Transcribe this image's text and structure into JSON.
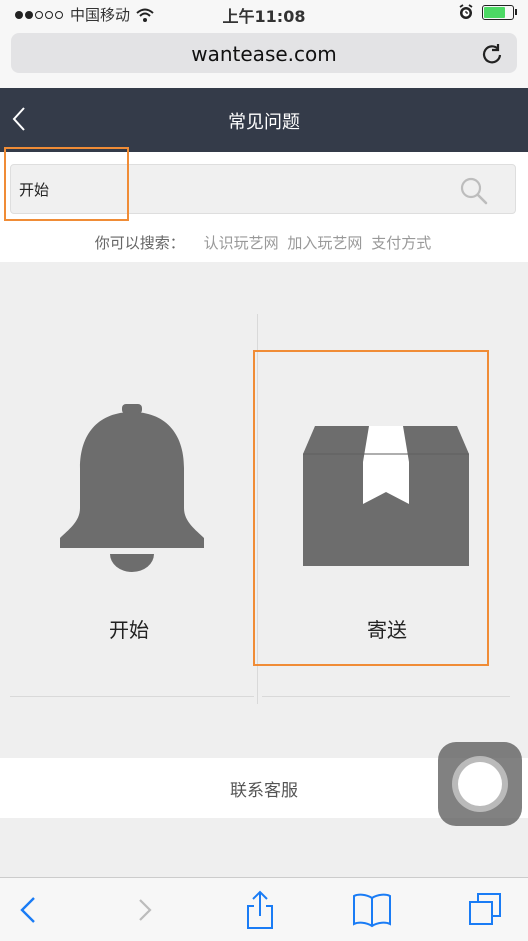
{
  "status_bar": {
    "carrier": "中国移动",
    "time": "上午11:08"
  },
  "browser": {
    "url": "wantease.com"
  },
  "header": {
    "title": "常见问题"
  },
  "search": {
    "value": "开始",
    "hint_label": "你可以搜索：",
    "hints": [
      "认识玩艺网",
      "加入玩艺网",
      "支付方式"
    ]
  },
  "categories": [
    {
      "label": "开始",
      "icon": "bell-icon"
    },
    {
      "label": "寄送",
      "icon": "package-icon"
    }
  ],
  "contact": {
    "label": "联系客服"
  },
  "colors": {
    "header_bg": "#343b49",
    "highlight": "#f08c36",
    "icon_gray": "#6d6d6d",
    "ios_blue": "#1a7cf5"
  }
}
